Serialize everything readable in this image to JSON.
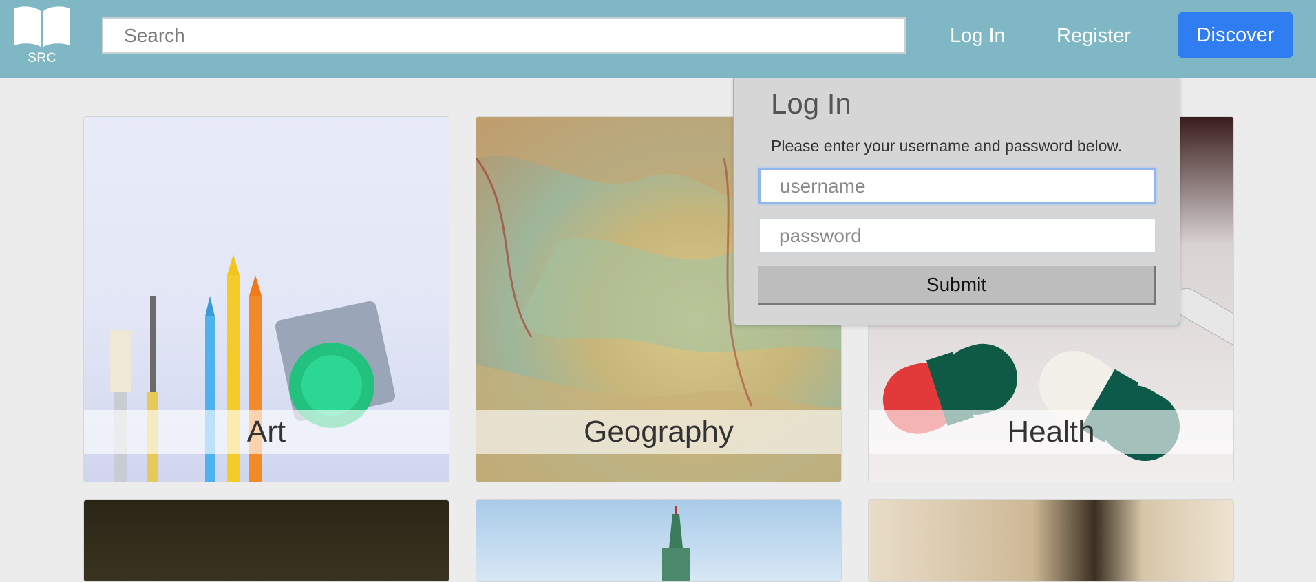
{
  "header": {
    "logo_text": "SRC",
    "search_placeholder": "Search",
    "nav": {
      "login": "Log In",
      "register": "Register",
      "discover": "Discover"
    }
  },
  "categories": [
    {
      "label": "Art"
    },
    {
      "label": "Geography"
    },
    {
      "label": "Health"
    }
  ],
  "login_panel": {
    "title": "Log In",
    "instructions": "Please enter your username and password below.",
    "username_placeholder": "username",
    "password_placeholder": "password",
    "submit_label": "Submit"
  },
  "colors": {
    "header": "#7fb8c4",
    "discover_button": "#2f7df1",
    "page_background": "#ececec",
    "login_panel": "#d6d6d6"
  }
}
